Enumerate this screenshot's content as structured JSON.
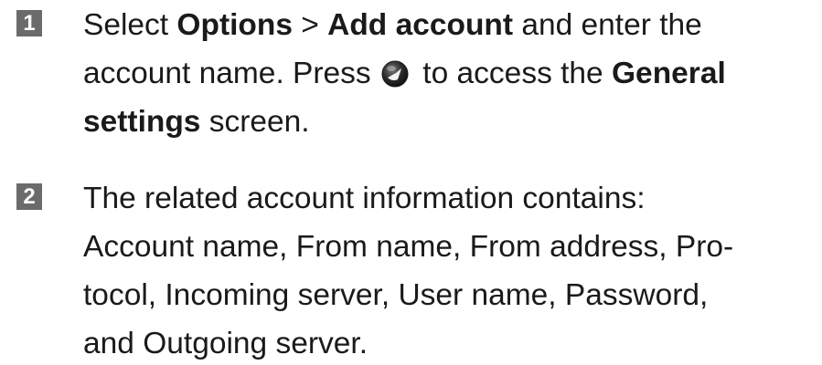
{
  "steps": [
    {
      "number": "1",
      "segments": {
        "s1": "Select ",
        "s2": "Options",
        "s3": " > ",
        "s4": "Add account",
        "s5": " and enter the",
        "s6": "account name. Press ",
        "s7": " to access the ",
        "s8": "General",
        "s9": "settings",
        "s10": " screen."
      },
      "icon": "nav-key-icon"
    },
    {
      "number": "2",
      "lines": [
        "The related account information contains:",
        "Account name, From name, From address, Pro-",
        "tocol, Incoming server, User name, Password,",
        "and Outgoing server."
      ]
    }
  ]
}
